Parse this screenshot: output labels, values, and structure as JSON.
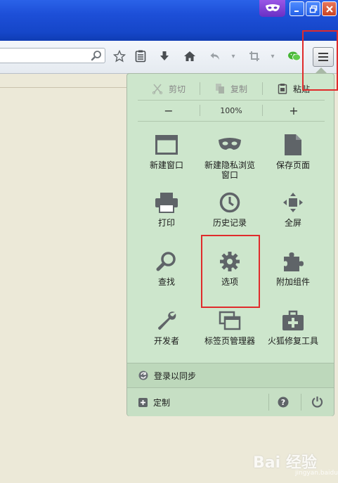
{
  "toolbar": {
    "icons": [
      "star-icon",
      "reader-list-icon",
      "download-icon",
      "home-icon",
      "back-icon",
      "dropdown-icon",
      "crop-icon",
      "dropdown-icon",
      "wechat-icon",
      "menu-icon"
    ]
  },
  "edit_row": {
    "cut": "剪切",
    "copy": "复制",
    "paste": "粘贴"
  },
  "zoom_row": {
    "minus": "−",
    "level": "100%",
    "plus": "+"
  },
  "menu_items": [
    {
      "label": "新建窗口",
      "icon": "new-window-icon"
    },
    {
      "label": "新建隐私浏览\n窗口",
      "icon": "private-mask-icon"
    },
    {
      "label": "保存页面",
      "icon": "save-page-icon"
    },
    {
      "label": "打印",
      "icon": "printer-icon"
    },
    {
      "label": "历史记录",
      "icon": "history-clock-icon"
    },
    {
      "label": "全屏",
      "icon": "fullscreen-icon"
    },
    {
      "label": "查找",
      "icon": "search-icon"
    },
    {
      "label": "选项",
      "icon": "gear-icon"
    },
    {
      "label": "附加组件",
      "icon": "puzzle-icon"
    },
    {
      "label": "开发者",
      "icon": "wrench-icon"
    },
    {
      "label": "标签页管理器",
      "icon": "tabs-manager-icon"
    },
    {
      "label": "火狐修复工具",
      "icon": "repair-kit-icon"
    }
  ],
  "footer": {
    "sync": "登录以同步",
    "customize": "定制"
  },
  "watermark": {
    "main": "Bai 经验",
    "sub": "jingyan.baidu.com"
  },
  "colors": {
    "panel_bg": "#cde6cc",
    "annotation_red": "#e02b2b",
    "icon_gray": "#5f6468",
    "title_blue": "#1d4fd8"
  }
}
